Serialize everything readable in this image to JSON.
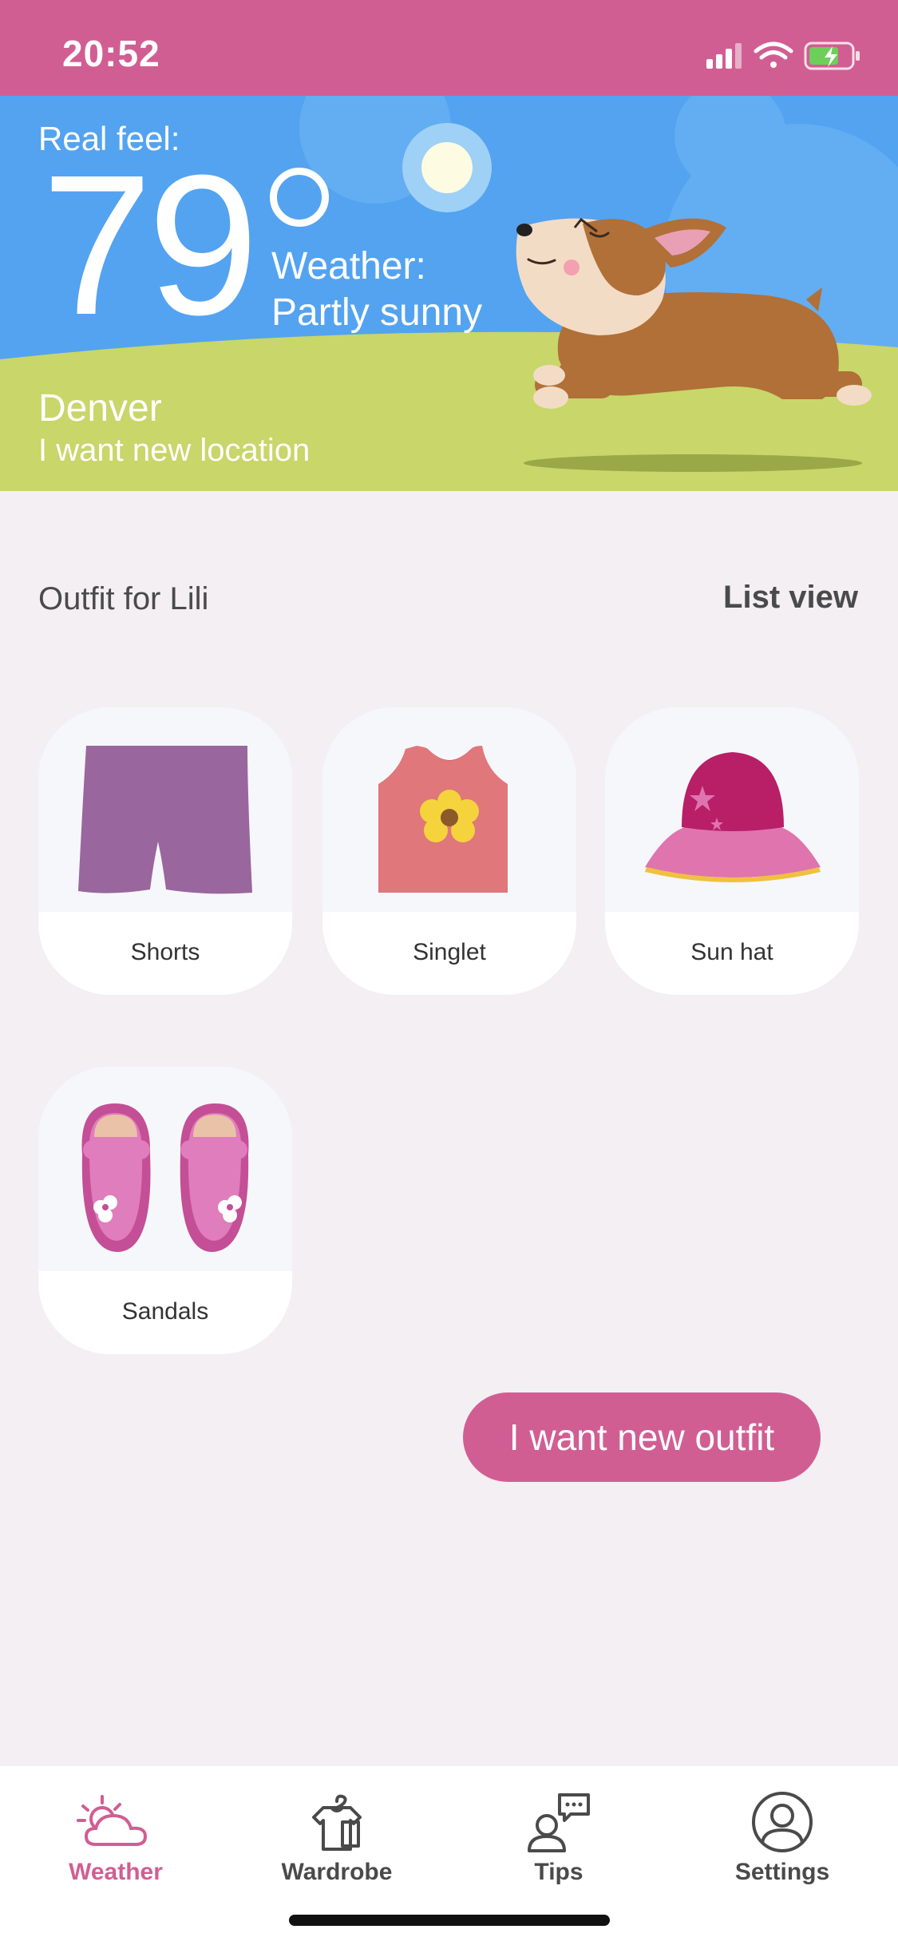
{
  "status_bar": {
    "time": "20:52"
  },
  "hero": {
    "real_feel_label": "Real feel:",
    "temperature": "79",
    "weather_label": "Weather:",
    "weather_value": "Partly sunny",
    "city": "Denver",
    "change_location": "I want new location"
  },
  "outfit": {
    "title": "Outfit for Lili",
    "list_view": "List view",
    "items": [
      {
        "label": "Shorts",
        "icon": "shorts-icon"
      },
      {
        "label": "Singlet",
        "icon": "singlet-icon"
      },
      {
        "label": "Sun hat",
        "icon": "sun-hat-icon"
      },
      {
        "label": "Sandals",
        "icon": "sandals-icon"
      }
    ],
    "new_outfit_button": "I want new outfit"
  },
  "tabs": [
    {
      "label": "Weather",
      "icon": "weather-icon",
      "active": true
    },
    {
      "label": "Wardrobe",
      "icon": "wardrobe-icon",
      "active": false
    },
    {
      "label": "Tips",
      "icon": "tips-icon",
      "active": false
    },
    {
      "label": "Settings",
      "icon": "settings-icon",
      "active": false
    }
  ],
  "colors": {
    "accent": "#d15e93",
    "sky": "#53a3f0",
    "grass": "#c8d66a",
    "background": "#f3eff3"
  }
}
